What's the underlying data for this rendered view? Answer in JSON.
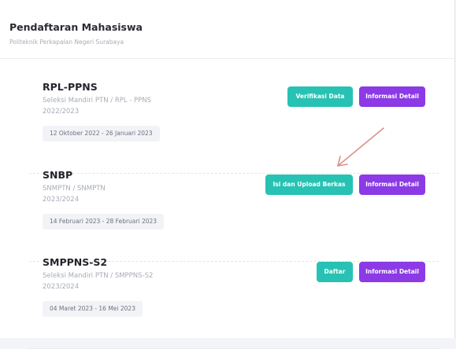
{
  "header": {
    "title": "Pendaftaran Mahasiswa",
    "subtitle": "Politeknik Perkapalan Negeri Surabaya"
  },
  "programs": [
    {
      "name": "RPL-PPNS",
      "path": "Seleksi Mandiri PTN / RPL - PPNS",
      "year": "2022/2023",
      "date_range": "12 Oktober 2022 - 26 Januari 2023",
      "primary_label": "Verifikasi Data",
      "detail_label": "Informasi Detail"
    },
    {
      "name": "SNBP",
      "path": "SNMPTN / SNMPTN",
      "year": "2023/2024",
      "date_range": "14 Februari 2023 - 28 Februari 2023",
      "primary_label": "Isi dan Upload Berkas",
      "detail_label": "Informasi Detail"
    },
    {
      "name": "SMPPNS-S2",
      "path": "Seleksi Mandiri PTN / SMPPNS-S2",
      "year": "2023/2024",
      "date_range": "04 Maret 2023 - 16 Mei 2023",
      "primary_label": "Daftar",
      "detail_label": "Informasi Detail"
    }
  ],
  "colors": {
    "teal": "#27c2b3",
    "purple": "#8b3ae6",
    "annotation_arrow": "#d9918c"
  }
}
